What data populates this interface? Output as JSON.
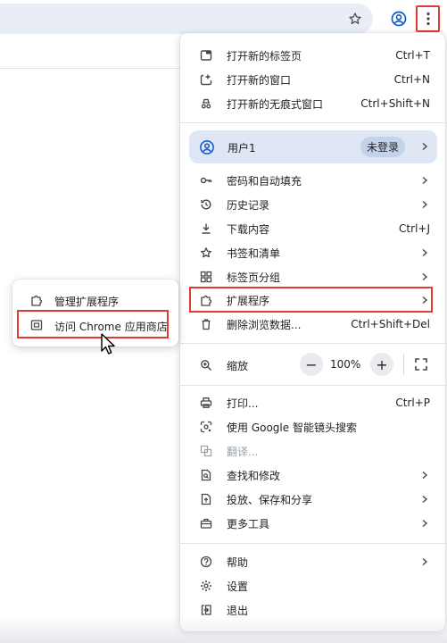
{
  "colors": {
    "highlight_red": "#e53935",
    "profile_bg": "#dfe7f5",
    "badge_bg": "#c5d3ea",
    "omnibox_bg": "#e9eef6"
  },
  "toolbar": {
    "star_icon": "star-icon",
    "profile_icon": "account-circle-icon",
    "menu_icon": "kebab-menu-icon"
  },
  "menu": {
    "new_tab": {
      "label": "打开新的标签页",
      "shortcut": "Ctrl+T"
    },
    "new_window": {
      "label": "打开新的窗口",
      "shortcut": "Ctrl+N"
    },
    "incognito": {
      "label": "打开新的无痕式窗口",
      "shortcut": "Ctrl+Shift+N"
    },
    "profile": {
      "label": "用户1",
      "badge": "未登录"
    },
    "passwords": {
      "label": "密码和自动填充"
    },
    "history": {
      "label": "历史记录"
    },
    "downloads": {
      "label": "下载内容",
      "shortcut": "Ctrl+J"
    },
    "bookmarks": {
      "label": "书签和清单"
    },
    "tab_groups": {
      "label": "标签页分组"
    },
    "extensions": {
      "label": "扩展程序"
    },
    "clear_data": {
      "label": "删除浏览数据...",
      "shortcut": "Ctrl+Shift+Del"
    },
    "zoom": {
      "label": "缩放",
      "value": "100%",
      "minus": "−",
      "plus": "+"
    },
    "print": {
      "label": "打印...",
      "shortcut": "Ctrl+P"
    },
    "google_lens": {
      "label": "使用 Google 智能镜头搜索"
    },
    "translate": {
      "label": "翻译..."
    },
    "find_edit": {
      "label": "查找和修改"
    },
    "cast_save_share": {
      "label": "投放、保存和分享"
    },
    "more_tools": {
      "label": "更多工具"
    },
    "help": {
      "label": "帮助"
    },
    "settings": {
      "label": "设置"
    },
    "exit": {
      "label": "退出"
    }
  },
  "submenu": {
    "manage": {
      "label": "管理扩展程序"
    },
    "store": {
      "label": "访问 Chrome 应用商店"
    }
  }
}
